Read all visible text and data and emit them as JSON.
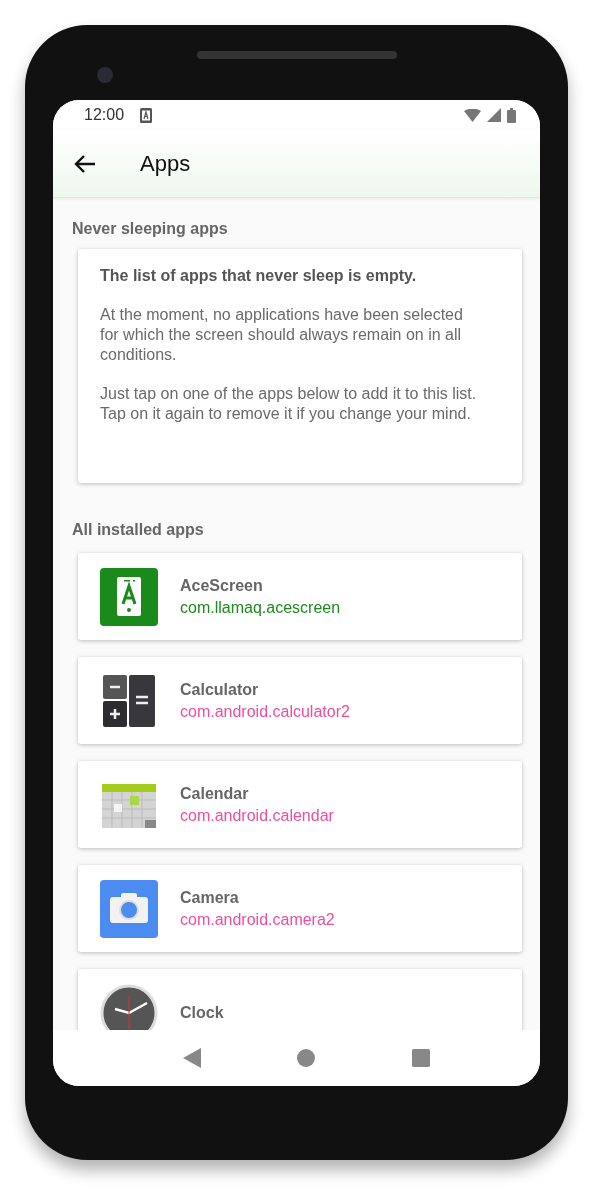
{
  "status_bar": {
    "time": "12:00"
  },
  "app_bar": {
    "title": "Apps"
  },
  "never_sleeping": {
    "heading": "Never sleeping apps",
    "empty_title": "The list of apps that never sleep is empty.",
    "paragraphs": [
      "At the moment, no applications have been selected for which the screen should always remain on in all conditions.",
      "Just tap on one of the apps below to add it to this list. Tap on it again to remove it if you change your mind."
    ]
  },
  "installed": {
    "heading": "All installed apps",
    "apps": [
      {
        "kind": "acescreen",
        "name": "AceScreen",
        "package": "com.llamaq.acescreen",
        "color": "#1e8a1e"
      },
      {
        "kind": "calculator",
        "name": "Calculator",
        "package": "com.android.calculator2",
        "color": "#ee4da0"
      },
      {
        "kind": "calendar",
        "name": "Calendar",
        "package": "com.android.calendar",
        "color": "#ee4da0"
      },
      {
        "kind": "camera",
        "name": "Camera",
        "package": "com.android.camera2",
        "color": "#ee4da0"
      },
      {
        "kind": "clock",
        "name": "Clock"
      }
    ]
  }
}
